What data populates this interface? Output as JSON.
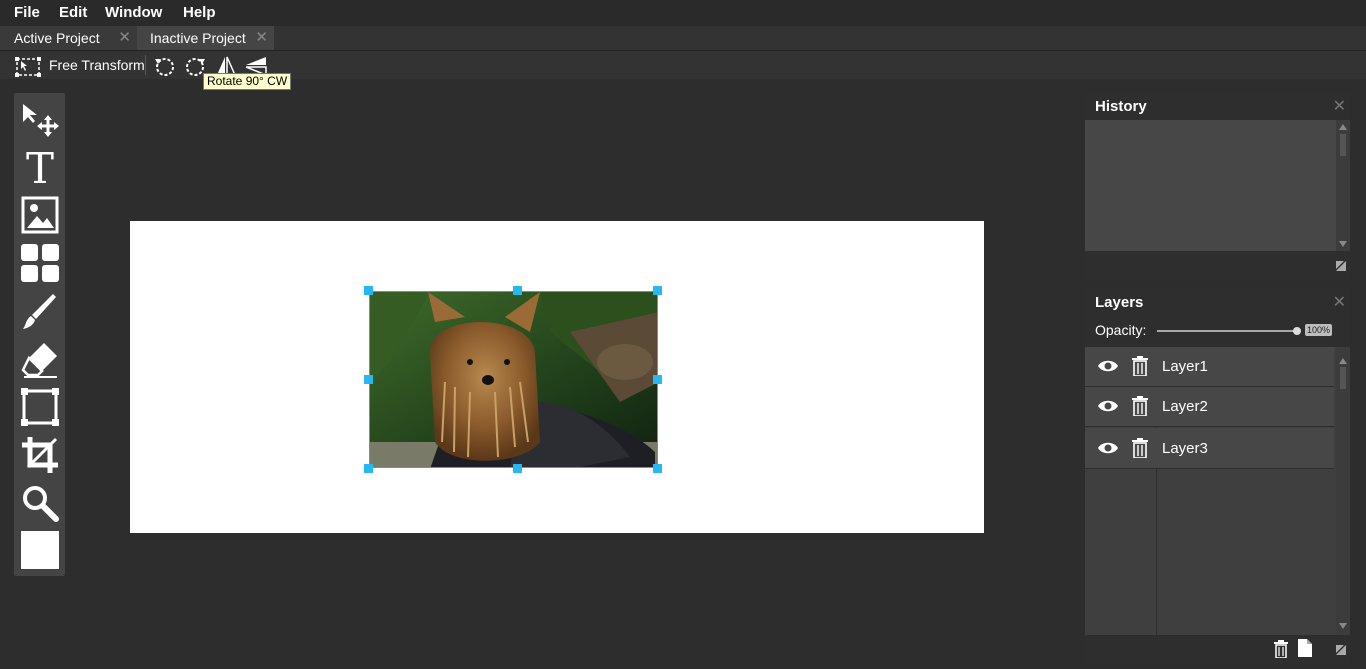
{
  "menu": [
    "File",
    "Edit",
    "Window",
    "Help"
  ],
  "tabs": [
    {
      "label": "Active Project",
      "close": "✕"
    },
    {
      "label": "Inactive Project",
      "close": "✕"
    }
  ],
  "tool_options": {
    "free_transform_label": "Free Transform",
    "icons": [
      "rotate-ccw-icon",
      "rotate-cw-icon",
      "flip-horizontal-icon",
      "flip-vertical-icon"
    ]
  },
  "tooltip": "Rotate 90° CW",
  "tools": [
    "move-tool-icon",
    "text-tool-icon",
    "image-tool-icon",
    "grid-tool-icon",
    "brush-tool-icon",
    "eraser-tool-icon",
    "transform-tool-icon",
    "crop-tool-icon",
    "zoom-tool-icon",
    "color-swatch-icon"
  ],
  "history": {
    "title": "History",
    "close": "✕"
  },
  "layers": {
    "title": "Layers",
    "close": "✕",
    "opacity_label": "Opacity:",
    "opacity_value": "100%",
    "opacity_fraction": 1.0,
    "items": [
      {
        "name": "Layer1"
      },
      {
        "name": "Layer2"
      },
      {
        "name": "Layer3"
      }
    ]
  },
  "colors": {
    "selection_accent": "#26b8f2",
    "tooltip_bg": "#ffffcc"
  }
}
